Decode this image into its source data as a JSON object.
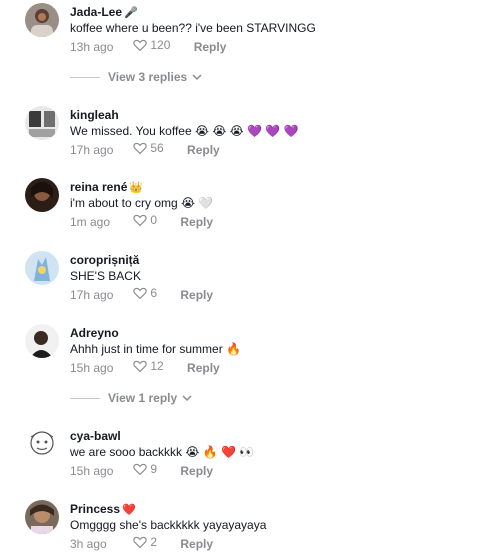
{
  "comments": [
    {
      "username": "Jada-Lee",
      "badge": "🎤",
      "text": "koffee where u been?? i've been STARVINGG",
      "time": "13h ago",
      "likes": "120",
      "reply": "Reply"
    },
    {
      "username": "kingleah",
      "badge": "",
      "text": "We missed. You koffee 😭 😭 😭 💜 💜 💜",
      "time": "17h ago",
      "likes": "56",
      "reply": "Reply"
    },
    {
      "username": "reina rené",
      "badge": "👑",
      "text": "i'm about to cry omg 😭 🤍",
      "time": "1m ago",
      "likes": "0",
      "reply": "Reply"
    },
    {
      "username": "coroprișniță",
      "badge": "",
      "text": "SHE'S BACK",
      "time": "17h ago",
      "likes": "6",
      "reply": "Reply"
    },
    {
      "username": "Adreyno",
      "badge": "",
      "text": "Ahhh just in time for summer 🔥",
      "time": "15h ago",
      "likes": "12",
      "reply": "Reply"
    },
    {
      "username": "cya-bawl",
      "badge": "",
      "text": "we are sooo backkkk 😭 🔥 ❤️ 👀",
      "time": "15h ago",
      "likes": "9",
      "reply": "Reply"
    },
    {
      "username": "Princess",
      "badge": "❤️",
      "text": "Omgggg she's backkkkk yayayayaya",
      "time": "3h ago",
      "likes": "2",
      "reply": "Reply"
    }
  ],
  "view_replies": [
    {
      "label": "View 3 replies"
    },
    {
      "label": "View 1 reply"
    }
  ],
  "colors": {
    "text_primary": "#161823",
    "text_secondary": "#8a8b91",
    "divider": "#c8c9cc"
  },
  "icons": {
    "like": "heart-outline-icon",
    "expand": "chevron-down-icon"
  }
}
